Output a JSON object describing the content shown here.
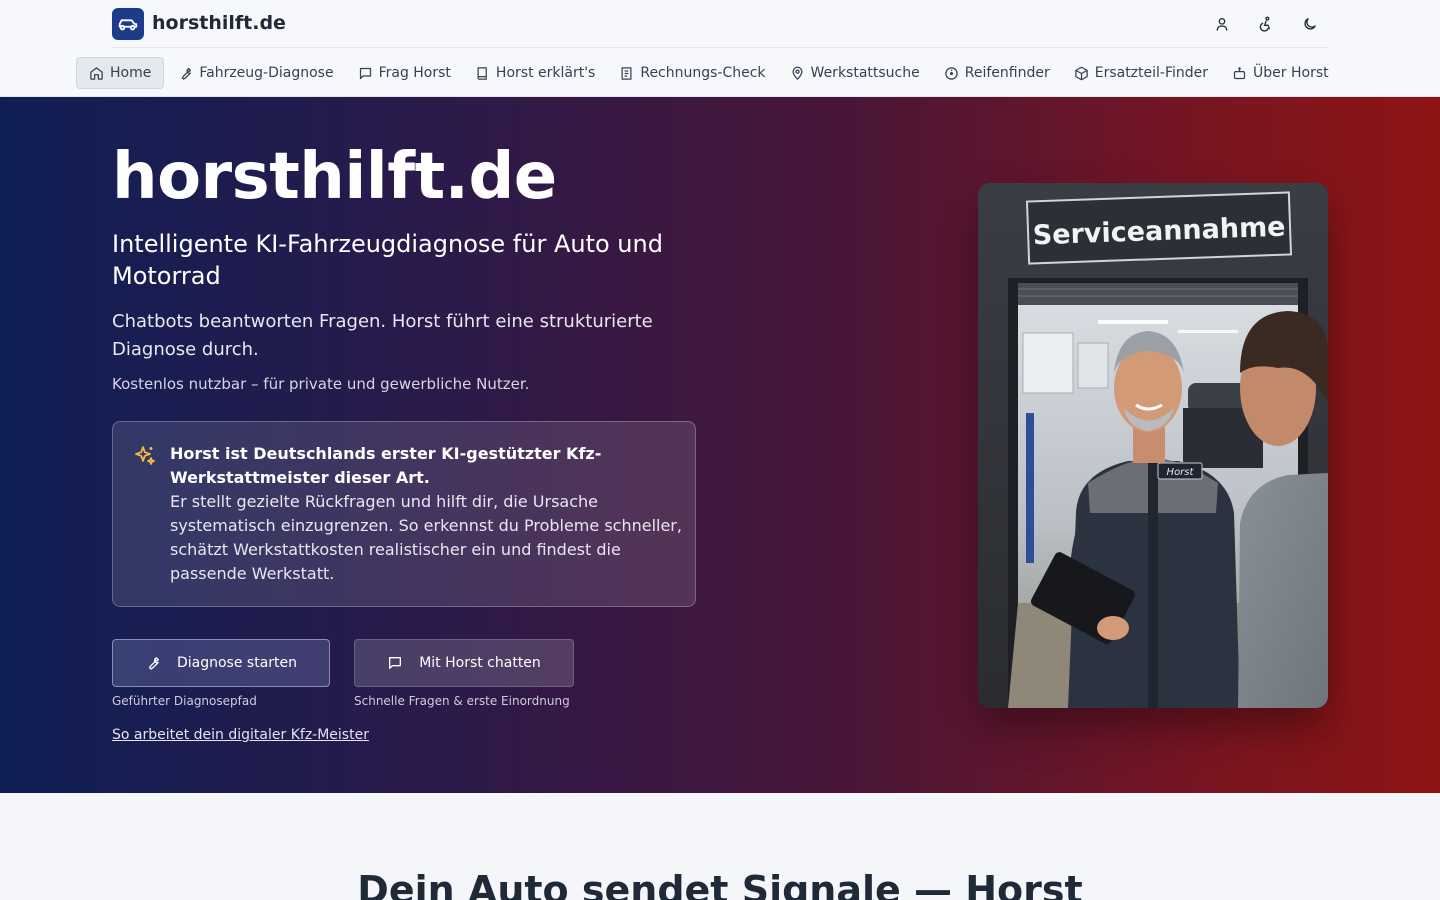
{
  "brand": {
    "name": "horsthilft.de"
  },
  "header_icons": {
    "account": "user-icon",
    "accessibility": "accessibility-icon",
    "theme": "moon-icon"
  },
  "nav": {
    "items": [
      {
        "label": "Home",
        "icon": "home-icon",
        "active": true
      },
      {
        "label": "Fahrzeug-Diagnose",
        "icon": "wrench-icon"
      },
      {
        "label": "Frag Horst",
        "icon": "chat-icon"
      },
      {
        "label": "Horst erklärt's",
        "icon": "book-icon"
      },
      {
        "label": "Rechnungs-Check",
        "icon": "receipt-icon"
      },
      {
        "label": "Werkstattsuche",
        "icon": "map-pin-icon"
      },
      {
        "label": "Reifenfinder",
        "icon": "tire-icon"
      },
      {
        "label": "Ersatzteil-Finder",
        "icon": "package-icon"
      },
      {
        "label": "Über Horst",
        "icon": "bot-icon"
      }
    ]
  },
  "hero": {
    "title": "horsthilft.de",
    "subtitle": "Intelligente KI-Fahrzeugdiagnose für Auto und Motorrad",
    "lead": "Chatbots beantworten Fragen. Horst führt eine strukturierte Diagnose durch.",
    "note": "Kostenlos nutzbar – für private und gewerbliche Nutzer.",
    "info": {
      "heading": "Horst ist Deutschlands erster KI-gestützter Kfz-Werkstattmeister dieser Art.",
      "body": "Er stellt gezielte Rückfragen und hilft dir, die Ursache systematisch einzugrenzen. So erkennst du Probleme schneller, schätzt Werkstattkosten realistischer ein und findest die passende Werkstatt."
    },
    "primary_cta": {
      "label": "Diagnose starten",
      "caption": "Geführter Diagnosepfad"
    },
    "secondary_cta": {
      "label": "Mit Horst chatten",
      "caption": "Schnelle Fragen & erste Einordnung"
    },
    "link": "So arbeitet dein digitaler Kfz-Meister",
    "image": {
      "sign_text": "Serviceannahme",
      "badge_text": "Horst"
    }
  },
  "section": {
    "title": "Dein Auto sendet Signale — Horst"
  },
  "colors": {
    "brand": "#1e3a8a",
    "hero_start": "#0f1f55",
    "hero_end": "#8e1414",
    "accent_star": "#f5b942"
  }
}
